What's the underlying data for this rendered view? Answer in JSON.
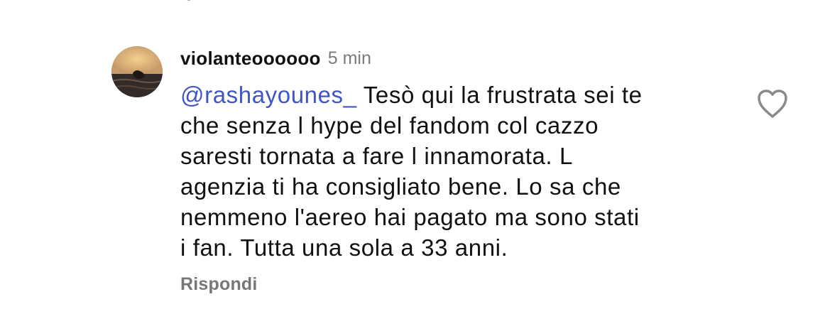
{
  "comment": {
    "username": "violanteoooooo",
    "time": "5 min",
    "mention": "@rashayounes_",
    "lines": [
      " Tesò qui la frustrata sei te",
      "che senza l hype del fandom col cazzo",
      "saresti tornata a fare l innamorata. L",
      "agenzia ti ha consigliato bene. Lo sa che",
      "nemmeno l'aereo hai pagato ma sono stati",
      "i fan. Tutta una sola a 33 anni."
    ],
    "reply_label": "Rispondi",
    "like_icon": "heart-outline-icon",
    "avatar": "profile-photo-avatar"
  }
}
